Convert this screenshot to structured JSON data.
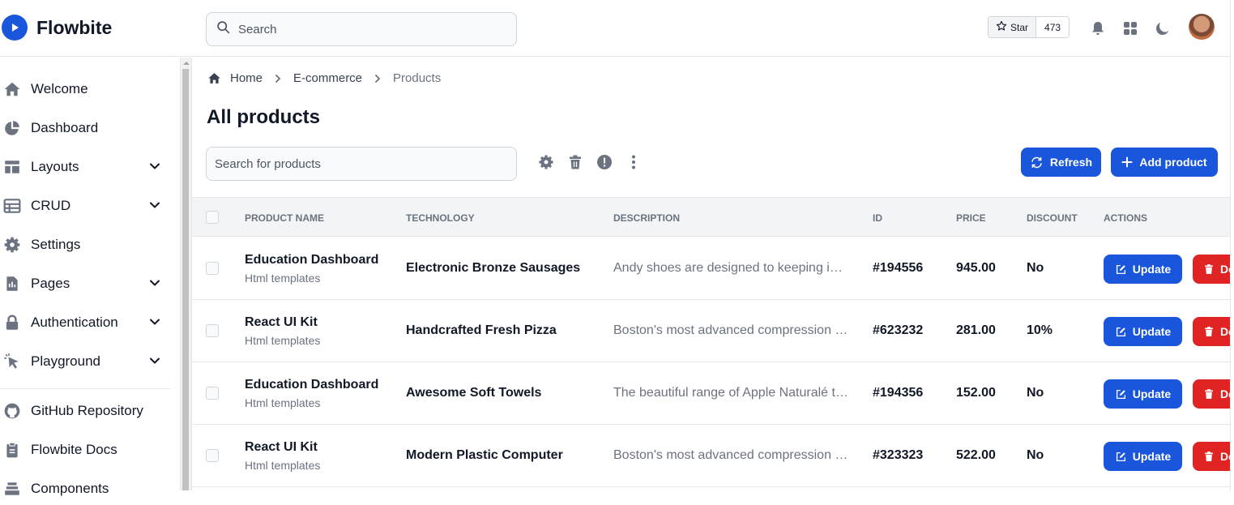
{
  "app": {
    "name": "Flowbite"
  },
  "header": {
    "search_placeholder": "Search",
    "star_label": "Star",
    "star_count": "473"
  },
  "sidebar": {
    "items": [
      {
        "label": "Welcome",
        "icon": "home-icon"
      },
      {
        "label": "Dashboard",
        "icon": "pie-chart-icon"
      },
      {
        "label": "Layouts",
        "icon": "layout-icon"
      },
      {
        "label": "CRUD",
        "icon": "table-icon"
      },
      {
        "label": "Settings",
        "icon": "gear-icon"
      },
      {
        "label": "Pages",
        "icon": "document-icon"
      },
      {
        "label": "Authentication",
        "icon": "lock-icon"
      },
      {
        "label": "Playground",
        "icon": "cursor-icon"
      }
    ],
    "links": [
      {
        "label": "GitHub Repository",
        "icon": "github-icon"
      },
      {
        "label": "Flowbite Docs",
        "icon": "clipboard-icon"
      },
      {
        "label": "Components",
        "icon": "stack-icon"
      }
    ]
  },
  "breadcrumb": {
    "home": "Home",
    "section": "E-commerce",
    "current": "Products"
  },
  "page": {
    "title": "All products",
    "search_placeholder": "Search for products"
  },
  "actions": {
    "refresh": "Refresh",
    "add": "Add product"
  },
  "table": {
    "headers": [
      "PRODUCT NAME",
      "TECHNOLOGY",
      "DESCRIPTION",
      "ID",
      "PRICE",
      "DISCOUNT",
      "ACTIONS"
    ],
    "update_label": "Update",
    "delete_label": "Delete",
    "rows": [
      {
        "name": "Education Dashboard",
        "category": "Html templates",
        "technology": "Electronic Bronze Sausages",
        "description": "Andy shoes are designed to keeping in mind durability",
        "id": "#194556",
        "price": "945.00",
        "discount": "No"
      },
      {
        "name": "React UI Kit",
        "category": "Html templates",
        "technology": "Handcrafted Fresh Pizza",
        "description": "Boston's most advanced compression wear technology",
        "id": "#623232",
        "price": "281.00",
        "discount": "10%"
      },
      {
        "name": "Education Dashboard",
        "category": "Html templates",
        "technology": "Awesome Soft Towels",
        "description": "The beautiful range of Apple Naturalé that has",
        "id": "#194356",
        "price": "152.00",
        "discount": "No"
      },
      {
        "name": "React UI Kit",
        "category": "Html templates",
        "technology": "Modern Plastic Computer",
        "description": "Boston's most advanced compression wear technology",
        "id": "#323323",
        "price": "522.00",
        "discount": "No"
      }
    ]
  },
  "colors": {
    "primary": "#1a56db",
    "danger": "#e02424"
  }
}
